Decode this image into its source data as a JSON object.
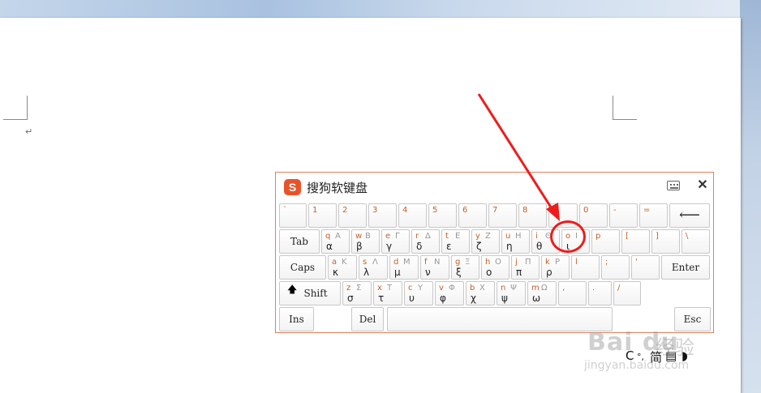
{
  "document": {
    "paragraph_mark": "↵"
  },
  "soft_keyboard": {
    "title": "搜狗软键盘",
    "logo_char": "S",
    "icons": {
      "keyboard": "keyboard-icon",
      "close": "close-icon",
      "close_glyph": "✕"
    },
    "rows": [
      [
        {
          "name": "grave",
          "tl": "`"
        },
        {
          "name": "1",
          "tl": "1"
        },
        {
          "name": "2",
          "tl": "2"
        },
        {
          "name": "3",
          "tl": "3"
        },
        {
          "name": "4",
          "tl": "4"
        },
        {
          "name": "5",
          "tl": "5"
        },
        {
          "name": "6",
          "tl": "6"
        },
        {
          "name": "7",
          "tl": "7"
        },
        {
          "name": "8",
          "tl": "8"
        },
        {
          "name": "9",
          "tl": ""
        },
        {
          "name": "0",
          "tl": "0"
        },
        {
          "name": "minus",
          "tl": "-"
        },
        {
          "name": "equals",
          "tl": "="
        },
        {
          "name": "backspace",
          "center": "⟵"
        }
      ],
      [
        {
          "name": "tab",
          "center": "Tab"
        },
        {
          "name": "q",
          "tl": "q",
          "tr": "Α",
          "bl": "α"
        },
        {
          "name": "w",
          "tl": "w",
          "tr": "Β",
          "bl": "β"
        },
        {
          "name": "e",
          "tl": "e",
          "tr": "Γ",
          "bl": "γ"
        },
        {
          "name": "r",
          "tl": "r",
          "tr": "Δ",
          "bl": "δ"
        },
        {
          "name": "t",
          "tl": "t",
          "tr": "Ε",
          "bl": "ε"
        },
        {
          "name": "y",
          "tl": "y",
          "tr": "Ζ",
          "bl": "ζ"
        },
        {
          "name": "u",
          "tl": "u",
          "tr": "Η",
          "bl": "η"
        },
        {
          "name": "i",
          "tl": "i",
          "tr": "Θ",
          "bl": "θ"
        },
        {
          "name": "o",
          "tl": "o",
          "tr": "Ι",
          "bl": "ι"
        },
        {
          "name": "p",
          "tl": "p"
        },
        {
          "name": "lbracket",
          "tl": "["
        },
        {
          "name": "rbracket",
          "tl": "]"
        },
        {
          "name": "backslash",
          "tl": "\\"
        }
      ],
      [
        {
          "name": "caps",
          "center": "Caps"
        },
        {
          "name": "a",
          "tl": "a",
          "tr": "Κ",
          "bl": "κ"
        },
        {
          "name": "s",
          "tl": "s",
          "tr": "Λ",
          "bl": "λ"
        },
        {
          "name": "d",
          "tl": "d",
          "tr": "Μ",
          "bl": "μ"
        },
        {
          "name": "f",
          "tl": "f",
          "tr": "Ν",
          "bl": "ν"
        },
        {
          "name": "g",
          "tl": "g",
          "tr": "Ξ",
          "bl": "ξ"
        },
        {
          "name": "h",
          "tl": "h",
          "tr": "Ο",
          "bl": "ο"
        },
        {
          "name": "j",
          "tl": "j",
          "tr": "Π",
          "bl": "π"
        },
        {
          "name": "k",
          "tl": "k",
          "tr": "Ρ",
          "bl": "ρ"
        },
        {
          "name": "l",
          "tl": "l"
        },
        {
          "name": "semicolon",
          "tl": ";"
        },
        {
          "name": "quote",
          "tl": "'"
        },
        {
          "name": "enter",
          "center": "Enter"
        }
      ],
      [
        {
          "name": "shift",
          "center": "Shift",
          "arrow": "🡅"
        },
        {
          "name": "z",
          "tl": "z",
          "tr": "Σ",
          "bl": "σ"
        },
        {
          "name": "x",
          "tl": "x",
          "tr": "Τ",
          "bl": "τ"
        },
        {
          "name": "c",
          "tl": "c",
          "tr": "Υ",
          "bl": "υ"
        },
        {
          "name": "v",
          "tl": "v",
          "tr": "Φ",
          "bl": "φ"
        },
        {
          "name": "b",
          "tl": "b",
          "tr": "Χ",
          "bl": "χ"
        },
        {
          "name": "n",
          "tl": "n",
          "tr": "Ψ",
          "bl": "ψ"
        },
        {
          "name": "m",
          "tl": "m",
          "tr": "Ω",
          "bl": "ω"
        },
        {
          "name": "comma",
          "tl": ","
        },
        {
          "name": "period",
          "tl": "."
        },
        {
          "name": "slash",
          "tl": "/"
        }
      ],
      [
        {
          "name": "ins",
          "center": "Ins"
        },
        {
          "name": "del",
          "center": "Del"
        },
        {
          "name": "space",
          "center": ""
        },
        {
          "name": "esc",
          "center": "Esc"
        }
      ]
    ]
  },
  "ime_status": {
    "mode": "C",
    "dot": "°,",
    "simplified": "简",
    "keyboard_glyph": "▤",
    "moon_glyph": "◗"
  },
  "watermark": {
    "logo": "Bai du",
    "text": "经验",
    "url": "jingyan.baidu.com"
  },
  "colors": {
    "accent": "#e8542a",
    "annotation": "#ee1c1c",
    "key_label": "#c0622a"
  }
}
